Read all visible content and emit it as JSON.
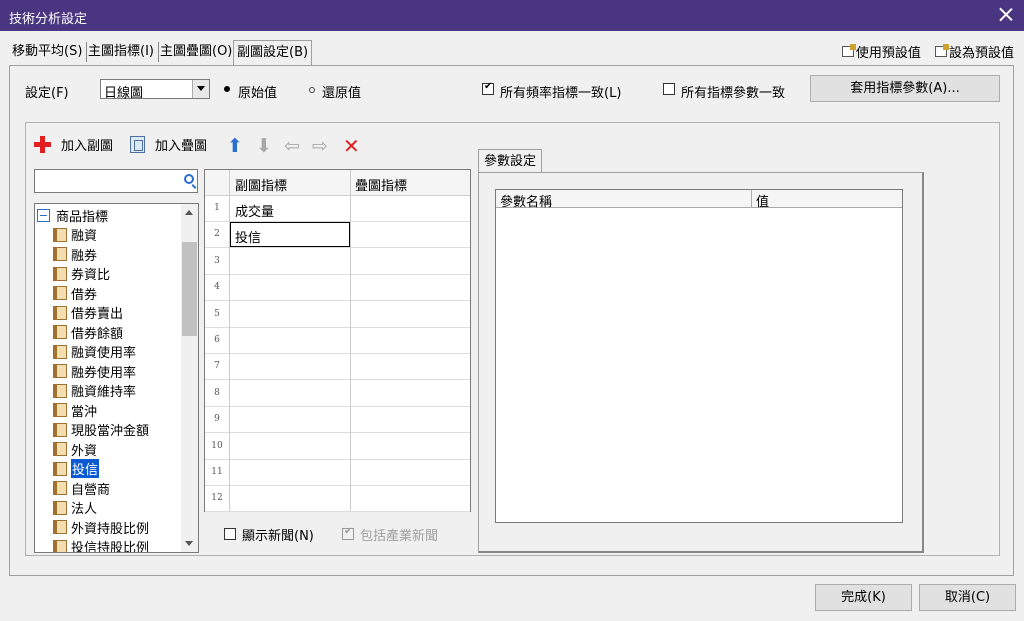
{
  "window": {
    "title": "技術分析設定"
  },
  "tabs": [
    {
      "label": "移動平均(S)"
    },
    {
      "label": "主圖指標(I)"
    },
    {
      "label": "主圖疊圖(O)"
    },
    {
      "label": "副圖設定(B)"
    }
  ],
  "top_links": {
    "use_default": "使用預設值",
    "set_default": "設為預設值"
  },
  "settings": {
    "label": "設定(F)",
    "combo_value": "日線圖",
    "radio_original": "原始值",
    "radio_restore": "還原值",
    "chk_all_freq": "所有頻率指標一致(L)",
    "chk_all_params": "所有指標參數一致",
    "apply_button": "套用指標參數(A)..."
  },
  "toolbar": {
    "add_sub": "加入副圖",
    "add_overlay": "加入疊圖"
  },
  "tree": {
    "root": "商品指標",
    "items": [
      "融資",
      "融券",
      "券資比",
      "借券",
      "借券賣出",
      "借券餘額",
      "融資使用率",
      "融券使用率",
      "融資維持率",
      "當沖",
      "現股當沖金額",
      "外資",
      "投信",
      "自營商",
      "法人",
      "外資持股比例",
      "投信持股比例"
    ]
  },
  "grid": {
    "col1": "副圖指標",
    "col2": "疊圖指標",
    "rows": [
      {
        "n": "1",
        "v": "成交量"
      },
      {
        "n": "2",
        "v": "投信"
      },
      {
        "n": "3",
        "v": ""
      },
      {
        "n": "4",
        "v": ""
      },
      {
        "n": "5",
        "v": ""
      },
      {
        "n": "6",
        "v": ""
      },
      {
        "n": "7",
        "v": ""
      },
      {
        "n": "8",
        "v": ""
      },
      {
        "n": "9",
        "v": ""
      },
      {
        "n": "10",
        "v": ""
      },
      {
        "n": "11",
        "v": ""
      },
      {
        "n": "12",
        "v": ""
      }
    ]
  },
  "options": {
    "show_news": "顯示新聞(N)",
    "include_industry": "包括產業新聞"
  },
  "param_panel": {
    "tab": "參數設定",
    "col_name": "參數名稱",
    "col_value": "值"
  },
  "footer": {
    "ok": "完成(K)",
    "cancel": "取消(C)"
  }
}
